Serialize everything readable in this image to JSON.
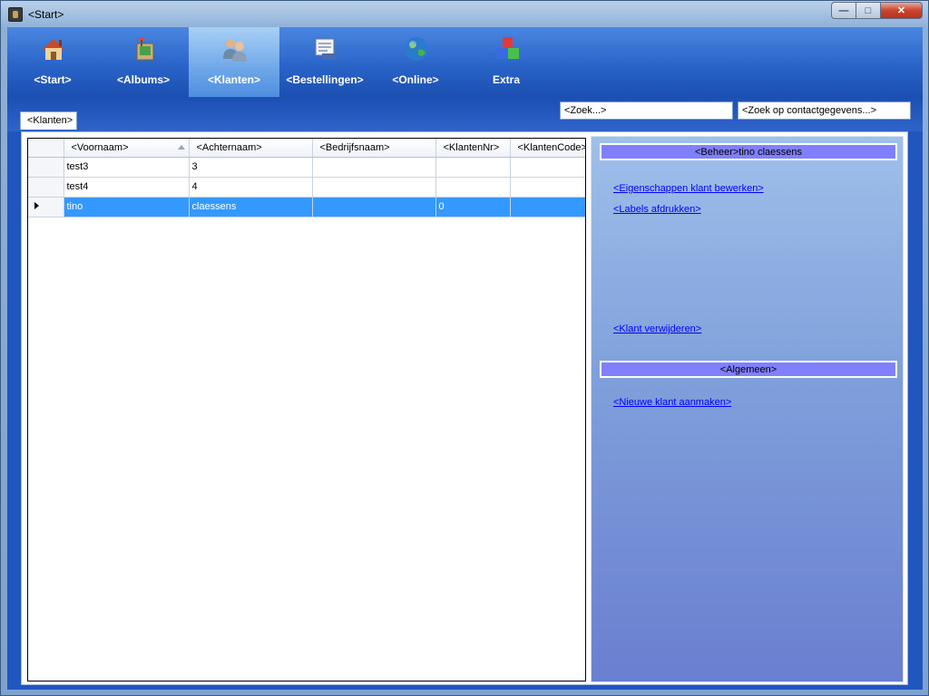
{
  "window": {
    "title": "<Start>"
  },
  "nav": [
    {
      "label": "<Start>",
      "icon": "house-icon"
    },
    {
      "label": "<Albums>",
      "icon": "album-icon"
    },
    {
      "label": "<Klanten>",
      "icon": "customers-icon",
      "active": true
    },
    {
      "label": "<Bestellingen>",
      "icon": "orders-icon"
    },
    {
      "label": "<Online>",
      "icon": "globe-icon"
    },
    {
      "label": "Extra",
      "icon": "blocks-icon"
    }
  ],
  "tab": {
    "label": "<Klanten>"
  },
  "search": {
    "zoek": "<Zoek...>",
    "zoek_contact": "<Zoek op contactgegevens...>"
  },
  "grid": {
    "columns": [
      "<Voornaam>",
      "<Achternaam>",
      "<Bedrijfsnaam>",
      "<KlantenNr>",
      "<KlantenCode>"
    ],
    "rows": [
      [
        "test3",
        "3",
        "",
        "",
        ""
      ],
      [
        "test4",
        "4",
        "",
        "",
        ""
      ],
      [
        "tino",
        "claessens",
        "",
        "0",
        ""
      ]
    ],
    "selected_row": 2
  },
  "side": {
    "beheer_header": "<Beheer>tino claessens",
    "links": {
      "edit": "<Eigenschappen klant bewerken>",
      "labels": "<Labels afdrukken>",
      "delete": "<Klant verwijderen>"
    },
    "algemeen_header": "<Algemeen>",
    "new_link": "<Nieuwe klant aanmaken>"
  },
  "colors": {
    "selected_row": "#3399ff",
    "side_header": "#8080ff",
    "ribbon": "#2a64c9"
  }
}
